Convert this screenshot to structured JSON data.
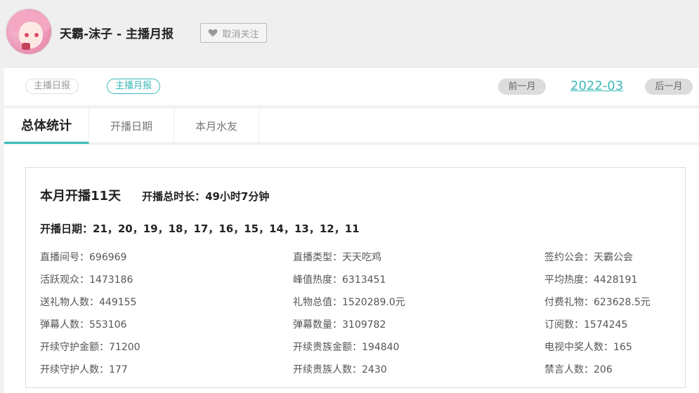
{
  "header": {
    "title": "天霸-沫子 - 主播月报",
    "unfollow_label": "取消关注"
  },
  "subnav": {
    "daily_label": "主播日报",
    "monthly_label": "主播月报",
    "prev_label": "前一月",
    "month": "2022-03",
    "next_label": "后一月"
  },
  "tabs": [
    {
      "label": "总体统计"
    },
    {
      "label": "开播日期"
    },
    {
      "label": "本月水友"
    }
  ],
  "summary": {
    "days": "本月开播11天",
    "duration": "开播总时长：49小时7分钟",
    "dates": "开播日期：21，20，19，18，17，16，15，14，13，12，11"
  },
  "stats": [
    [
      "直播间号：696969",
      "直播类型：天天吃鸡",
      "签约公会：天霸公会"
    ],
    [
      "活跃观众：1473186",
      "峰值热度：6313451",
      "平均热度：4428191"
    ],
    [
      "送礼物人数：449155",
      "礼物总值：1520289.0元",
      "付费礼物：623628.5元"
    ],
    [
      "弹幕人数：553106",
      "弹幕数量：3109782",
      "订阅数：1574245"
    ],
    [
      "开续守护金额：71200",
      "开续贵族金额：194840",
      "电视中奖人数：165"
    ],
    [
      "开续守护人数：177",
      "开续贵族人数：2430",
      "禁言人数：206"
    ]
  ],
  "colors": {
    "accent": "#3ab8b8",
    "background": "#f2f2f2"
  },
  "icons": {
    "unfollow": "heart-icon"
  }
}
